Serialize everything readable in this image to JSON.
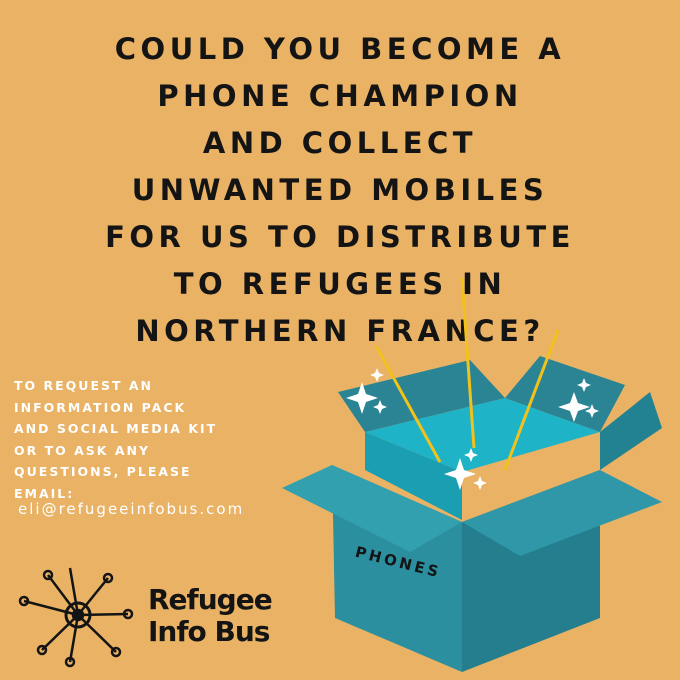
{
  "headline": [
    "COULD YOU BECOME A",
    "PHONE CHAMPION",
    "AND COLLECT",
    "UNWANTED MOBILES",
    "FOR US TO DISTRIBUTE",
    "TO REFUGEES IN",
    "NORTHERN FRANCE?"
  ],
  "info": [
    "TO REQUEST  AN",
    "INFORMATION PACK",
    "AND SOCIAL MEDIA KIT",
    "OR TO ASK  ANY",
    "QUESTIONS, PLEASE",
    "EMAIL:"
  ],
  "email": "eli@refugeeinfobus.com",
  "box_label": "PHONES",
  "logo": {
    "line1": "Refugee",
    "line2": "Info Bus"
  },
  "colors": {
    "background": "#e9b265",
    "box_teal": "#2b8f9f",
    "box_inner": "#1fb3c8",
    "ray": "#f2c21a"
  }
}
